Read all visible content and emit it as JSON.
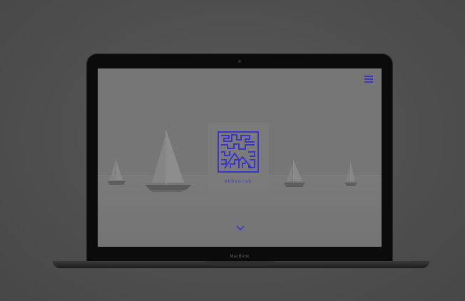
{
  "device": {
    "label": "MacBook"
  },
  "site": {
    "brand_text": "ebbsorab",
    "accent_color": "#3b36c9",
    "menu_icon": "hamburger-menu-icon",
    "scroll_icon": "chevron-down-icon"
  }
}
